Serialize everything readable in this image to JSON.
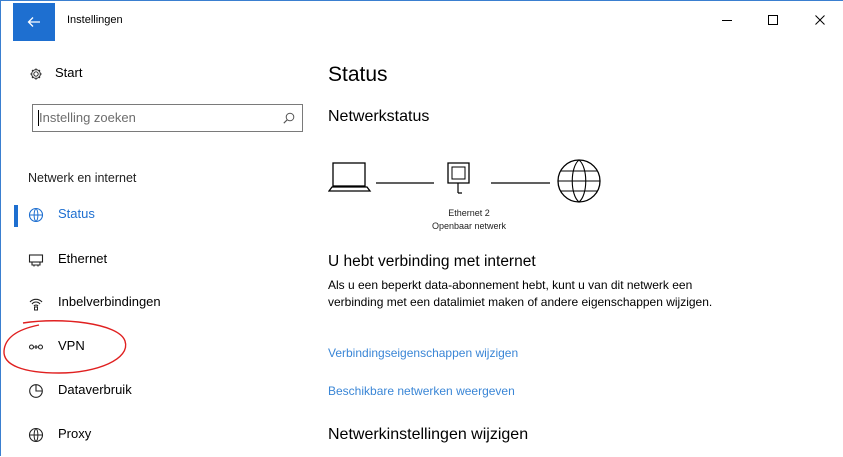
{
  "window": {
    "title": "Instellingen",
    "controls": {
      "minimize": "minimize-icon",
      "maximize": "maximize-icon",
      "close": "close-icon"
    }
  },
  "sidebar": {
    "start_label": "Start",
    "search": {
      "placeholder": "Instelling zoeken"
    },
    "section_label": "Netwerk en internet",
    "items": [
      {
        "label": "Status",
        "icon": "globe-status-icon",
        "active": true
      },
      {
        "label": "Ethernet",
        "icon": "ethernet-icon",
        "active": false
      },
      {
        "label": "Inbelverbindingen",
        "icon": "dialup-icon",
        "active": false
      },
      {
        "label": "VPN",
        "icon": "vpn-icon",
        "active": false
      },
      {
        "label": "Dataverbruik",
        "icon": "data-usage-icon",
        "active": false
      },
      {
        "label": "Proxy",
        "icon": "globe-icon",
        "active": false
      }
    ]
  },
  "main": {
    "title": "Status",
    "network_status_heading": "Netwerkstatus",
    "adapter_name": "Ethernet 2",
    "network_type": "Openbaar netwerk",
    "connection_title": "U hebt verbinding met internet",
    "connection_description": "Als u een beperkt data-abonnement hebt, kunt u van dit netwerk een verbinding met een datalimiet maken of andere eigenschappen wijzigen.",
    "link_properties": "Verbindingseigenschappen wijzigen",
    "link_networks": "Beschikbare netwerken weergeven",
    "settings_heading": "Netwerkinstellingen wijzigen"
  },
  "colors": {
    "accent": "#1e6fd0",
    "link": "#3a86d6",
    "annotation": "#e02020"
  }
}
